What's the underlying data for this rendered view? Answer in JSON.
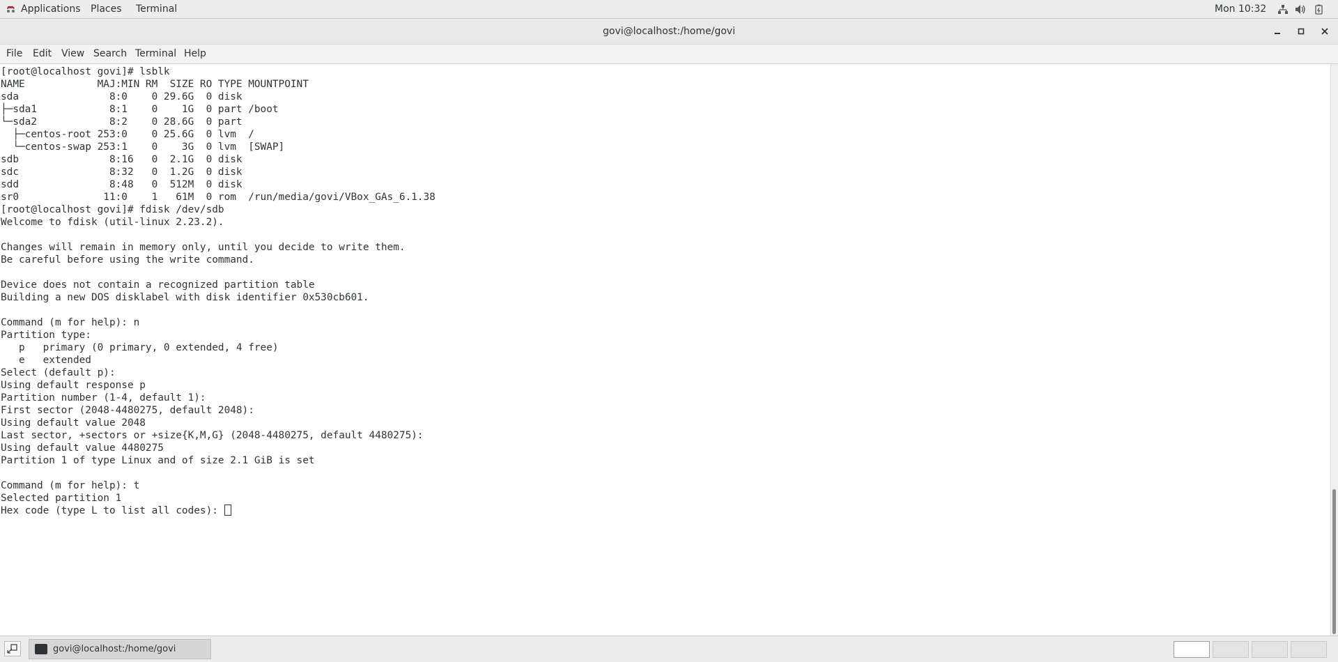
{
  "top_panel": {
    "applications": "Applications",
    "places": "Places",
    "terminal": "Terminal",
    "clock": "Mon 10:32",
    "icons": [
      "network-icon",
      "volume-icon",
      "power-icon"
    ]
  },
  "window": {
    "title": "govi@localhost:/home/govi"
  },
  "menubar": {
    "file": "File",
    "edit": "Edit",
    "view": "View",
    "search": "Search",
    "terminal": "Terminal",
    "help": "Help"
  },
  "terminal": {
    "output": "[root@localhost govi]# lsblk\nNAME            MAJ:MIN RM  SIZE RO TYPE MOUNTPOINT\nsda               8:0    0 29.6G  0 disk \n├─sda1            8:1    0    1G  0 part /boot\n└─sda2            8:2    0 28.6G  0 part \n  ├─centos-root 253:0    0 25.6G  0 lvm  /\n  └─centos-swap 253:1    0    3G  0 lvm  [SWAP]\nsdb               8:16   0  2.1G  0 disk \nsdc               8:32   0  1.2G  0 disk \nsdd               8:48   0  512M  0 disk \nsr0              11:0    1   61M  0 rom  /run/media/govi/VBox_GAs_6.1.38\n[root@localhost govi]# fdisk /dev/sdb\nWelcome to fdisk (util-linux 2.23.2).\n\nChanges will remain in memory only, until you decide to write them.\nBe careful before using the write command.\n\nDevice does not contain a recognized partition table\nBuilding a new DOS disklabel with disk identifier 0x530cb601.\n\nCommand (m for help): n\nPartition type:\n   p   primary (0 primary, 0 extended, 4 free)\n   e   extended\nSelect (default p): \nUsing default response p\nPartition number (1-4, default 1): \nFirst sector (2048-4480275, default 2048): \nUsing default value 2048\nLast sector, +sectors or +size{K,M,G} (2048-4480275, default 4480275): \nUsing default value 4480275\nPartition 1 of type Linux and of size 2.1 GiB is set\n\nCommand (m for help): t\nSelected partition 1\n",
    "prompt": "Hex code (type L to list all codes): "
  },
  "taskbar": {
    "task_label": "govi@localhost:/home/govi",
    "workspaces": 4,
    "active_workspace": 1
  }
}
